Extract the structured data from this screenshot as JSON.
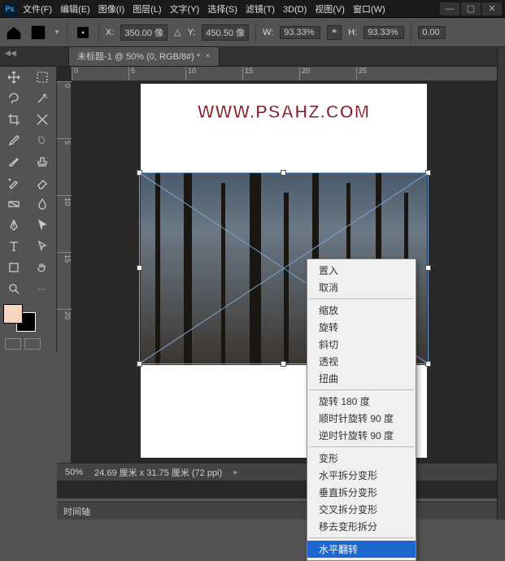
{
  "menu": [
    "文件(F)",
    "编辑(E)",
    "图像(I)",
    "图层(L)",
    "文字(Y)",
    "选择(S)",
    "滤镜(T)",
    "3D(D)",
    "视图(V)",
    "窗口(W)"
  ],
  "options": {
    "x_label": "X:",
    "x_val": "350.00 像",
    "y_label": "Y:",
    "y_val": "450.50 像",
    "w_label": "W:",
    "w_val": "93.33%",
    "h_label": "H:",
    "h_val": "93.33%",
    "extra": "0.00"
  },
  "doc_tab": "未标题-1 @ 50% (0, RGB/8#) *",
  "ruler_h": [
    "0",
    "5",
    "10",
    "15",
    "20",
    "25"
  ],
  "ruler_v": [
    "0",
    "5",
    "10",
    "15",
    "20"
  ],
  "watermark": "WWW.PSAHZ.COM",
  "ctx_menu": {
    "group1": [
      "置入",
      "取消"
    ],
    "group2": [
      "缩放",
      "旋转",
      "斜切",
      "透视",
      "扭曲"
    ],
    "group3": [
      "旋转 180 度",
      "顺时针旋转 90 度",
      "逆时针旋转 90 度"
    ],
    "group4": [
      "变形",
      "水平拆分变形",
      "垂直拆分变形",
      "交叉拆分变形",
      "移去变形拆分"
    ],
    "highlight": "水平翻转"
  },
  "status": {
    "zoom": "50%",
    "dims": "24.69 厘米 x 31.75 厘米 (72 ppi)"
  },
  "timeline_label": "时间轴",
  "swatch": {
    "fg": "#f8d5c0",
    "bg": "#000000"
  },
  "triangle": "▸",
  "link_glyph": "⚭"
}
